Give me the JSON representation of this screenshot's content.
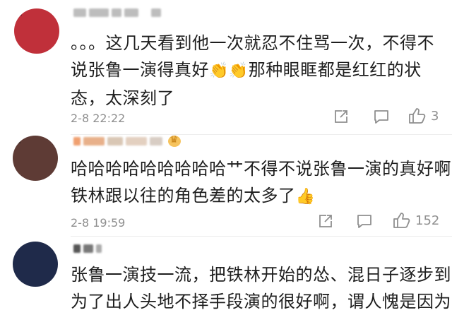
{
  "comments": [
    {
      "text_lines": [
        "。。。这几天看到他一次就忍不住骂一次，不得不",
        "说张鲁一演得真好",
        "那种眼眶都是红红的状",
        "态，太深刻了"
      ],
      "emoji": "👏👏",
      "time": "2-8 22:22",
      "like_count": "3",
      "avatar_colors": [
        "#c0303a",
        "#d99aa0",
        "#8c1f2a",
        "#e8c6c9"
      ]
    },
    {
      "text_lines": [
        "哈哈哈哈哈哈哈哈哈艹不得不说张鲁一演的真好啊",
        "铁林跟以往的角色差的太多了"
      ],
      "emoji": "👍",
      "time": "2-8 19:59",
      "like_count": "152",
      "avatar_colors": [
        "#5e3b35",
        "#b08b7d",
        "#e2cdc2",
        "#3a2521"
      ]
    },
    {
      "text_lines": [
        "张鲁一演技一流，把铁林开始的怂、混日子逐步到",
        "为了出人头地不择手段演的很好啊，谓人愧是因为"
      ],
      "avatar_colors": [
        "#1f2a4a",
        "#7c8bb0",
        "#c6cde0",
        "#3b4a75"
      ]
    }
  ],
  "icons": {
    "share": "share-icon",
    "comment": "comment-icon",
    "like": "thumbs-up-icon"
  }
}
